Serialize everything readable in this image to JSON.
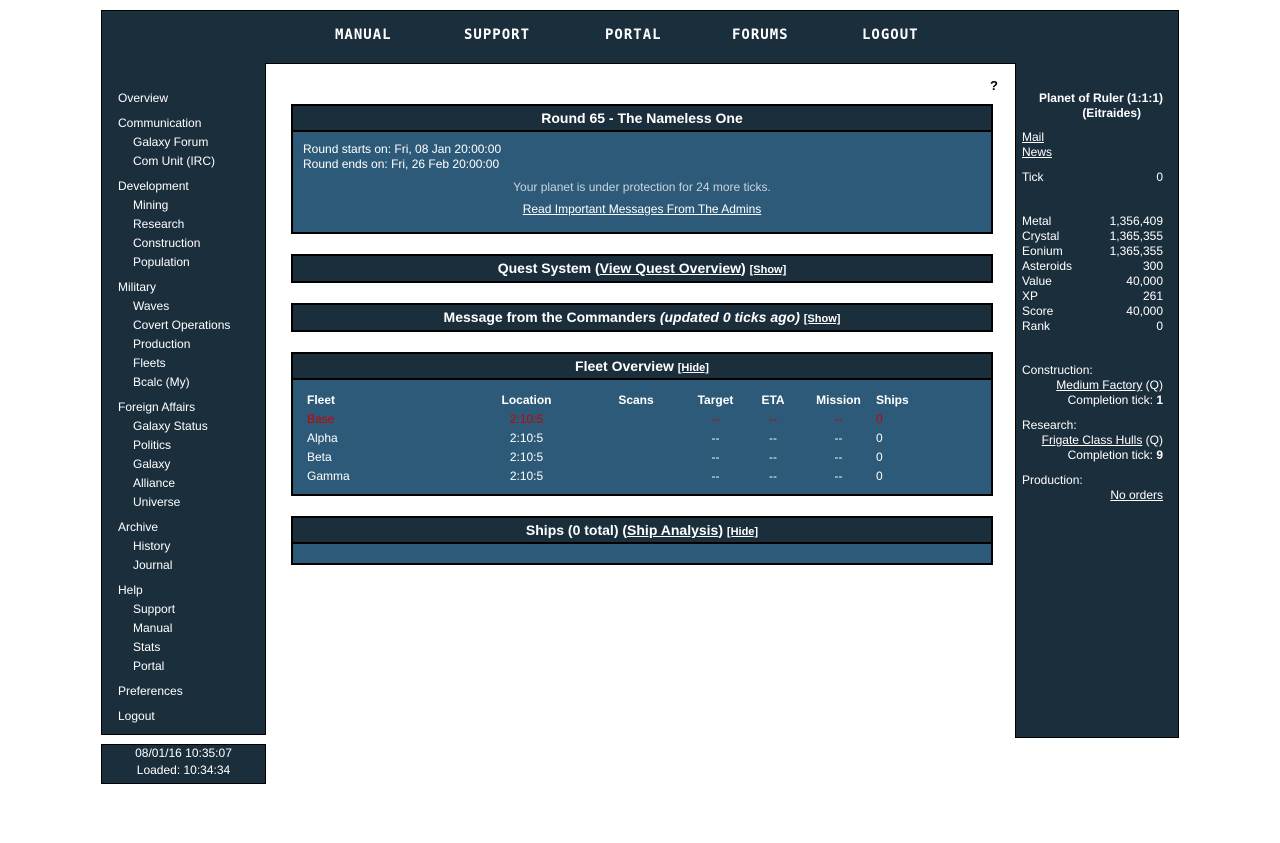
{
  "topnav": [
    "MANUAL",
    "SUPPORT",
    "PORTAL",
    "FORUMS",
    "LOGOUT"
  ],
  "sidebar": {
    "overview": "Overview",
    "communication": "Communication",
    "galaxy_forum": "Galaxy Forum",
    "com_unit": "Com Unit (IRC)",
    "development": "Development",
    "mining": "Mining",
    "research": "Research",
    "construction": "Construction",
    "population": "Population",
    "military": "Military",
    "waves": "Waves",
    "covert_ops": "Covert Operations",
    "production": "Production",
    "fleets": "Fleets",
    "bcalc": "Bcalc (My)",
    "foreign_affairs": "Foreign Affairs",
    "galaxy_status": "Galaxy Status",
    "politics": "Politics",
    "galaxy": "Galaxy",
    "alliance": "Alliance",
    "universe": "Universe",
    "archive": "Archive",
    "history": "History",
    "journal": "Journal",
    "help": "Help",
    "support": "Support",
    "manual": "Manual",
    "stats": "Stats",
    "portal": "Portal",
    "preferences": "Preferences",
    "logout": "Logout"
  },
  "clock": {
    "date": "08/01/16 10:35:07",
    "loaded": "Loaded: 10:34:34"
  },
  "help_mark": "?",
  "round": {
    "title": "Round 65 - The Nameless One",
    "starts": "Round starts on: Fri, 08 Jan 20:00:00",
    "ends": "Round ends on: Fri, 26 Feb 20:00:00",
    "protection": "Your planet is under protection for 24 more ticks.",
    "admin_link": "Read Important Messages From The Admins"
  },
  "quest": {
    "title": "Quest System (",
    "link": "View Quest Overview",
    "close": ")",
    "toggle": "[Show]"
  },
  "message": {
    "title": "Message from the Commanders ",
    "updated": "(updated 0 ticks ago)",
    "toggle": "[Show]"
  },
  "fleet_overview": {
    "title": "Fleet Overview",
    "toggle": "[Hide]",
    "headers": [
      "Fleet",
      "Location",
      "Scans",
      "Target",
      "ETA",
      "Mission",
      "Ships"
    ],
    "rows": [
      {
        "fleet": "Base",
        "location": "2:10:5",
        "scans": "",
        "target": "--",
        "eta": "--",
        "mission": "--",
        "ships": "0"
      },
      {
        "fleet": "Alpha",
        "location": "2:10:5",
        "scans": "",
        "target": "--",
        "eta": "--",
        "mission": "--",
        "ships": "0"
      },
      {
        "fleet": "Beta",
        "location": "2:10:5",
        "scans": "",
        "target": "--",
        "eta": "--",
        "mission": "--",
        "ships": "0"
      },
      {
        "fleet": "Gamma",
        "location": "2:10:5",
        "scans": "",
        "target": "--",
        "eta": "--",
        "mission": "--",
        "ships": "0"
      }
    ],
    "base_color": "#cc0000"
  },
  "ships": {
    "title": "Ships (0 total) (",
    "link": "Ship Analysis",
    "close": ")",
    "toggle": "[Hide]"
  },
  "planet": {
    "name": "Planet of Ruler (1:1:1)",
    "race": "(Eitraides)",
    "mail": "Mail",
    "news": "News",
    "tick_label": "Tick",
    "tick": "0",
    "stats": [
      {
        "label": "Metal",
        "value": "1,356,409"
      },
      {
        "label": "Crystal",
        "value": "1,365,355"
      },
      {
        "label": "Eonium",
        "value": "1,365,355"
      },
      {
        "label": "Asteroids",
        "value": "300"
      },
      {
        "label": "Value",
        "value": "40,000"
      },
      {
        "label": "XP",
        "value": "261"
      },
      {
        "label": "Score",
        "value": "40,000"
      },
      {
        "label": "Rank",
        "value": "0"
      }
    ],
    "construction_label": "Construction:",
    "construction_item": "Medium Factory",
    "construction_q": " (Q)",
    "construction_tick_label": "Completion tick: ",
    "construction_tick": "1",
    "research_label": "Research:",
    "research_item": "Frigate Class Hulls",
    "research_q": " (Q)",
    "research_tick_label": "Completion tick: ",
    "research_tick": "9",
    "production_label": "Production:",
    "production_orders": "No orders"
  }
}
